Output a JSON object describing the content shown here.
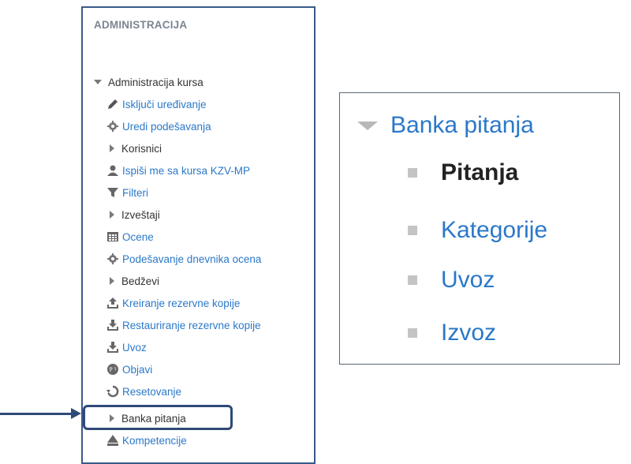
{
  "admin_block": {
    "title": "ADMINISTRACIJA",
    "course_admin": {
      "label": "Administracija kursa",
      "items": [
        {
          "label": "Isključi uređivanje",
          "icon": "pencil-icon",
          "type": "link"
        },
        {
          "label": "Uredi podešavanja",
          "icon": "gear-icon",
          "type": "link"
        },
        {
          "label": "Korisnici",
          "icon": "expand-arrow-icon",
          "type": "folder"
        },
        {
          "label": "Ispiši me sa kursa KZV-MP",
          "icon": "user-icon",
          "type": "link"
        },
        {
          "label": "Filteri",
          "icon": "filter-icon",
          "type": "link"
        },
        {
          "label": "Izveštaji",
          "icon": "expand-arrow-icon",
          "type": "folder"
        },
        {
          "label": "Ocene",
          "icon": "grades-table-icon",
          "type": "link"
        },
        {
          "label": "Podešavanje dnevnika ocena",
          "icon": "gear-icon",
          "type": "link"
        },
        {
          "label": "Bedževi",
          "icon": "expand-arrow-icon",
          "type": "folder"
        },
        {
          "label": "Kreiranje rezervne kopije",
          "icon": "upload-icon",
          "type": "link"
        },
        {
          "label": "Restauriranje rezervne kopije",
          "icon": "download-icon",
          "type": "link"
        },
        {
          "label": "Uvoz",
          "icon": "download-icon",
          "type": "link"
        },
        {
          "label": "Objavi",
          "icon": "globe-icon",
          "type": "link"
        },
        {
          "label": "Resetovanje",
          "icon": "reset-icon",
          "type": "link"
        },
        {
          "label": "Banka pitanja",
          "icon": "expand-arrow-icon",
          "type": "folder"
        },
        {
          "label": "Kompetencije",
          "icon": "competency-icon",
          "type": "link"
        }
      ]
    }
  },
  "zoom_panel": {
    "header": "Banka pitanja",
    "items": [
      {
        "label": "Pitanja",
        "active": true
      },
      {
        "label": "Kategorije",
        "active": false
      },
      {
        "label": "Uvoz",
        "active": false
      },
      {
        "label": "Izvoz",
        "active": false
      }
    ]
  },
  "colors": {
    "link": "#2b78c8",
    "highlight": "#2e4a78",
    "title": "#7b8591"
  }
}
